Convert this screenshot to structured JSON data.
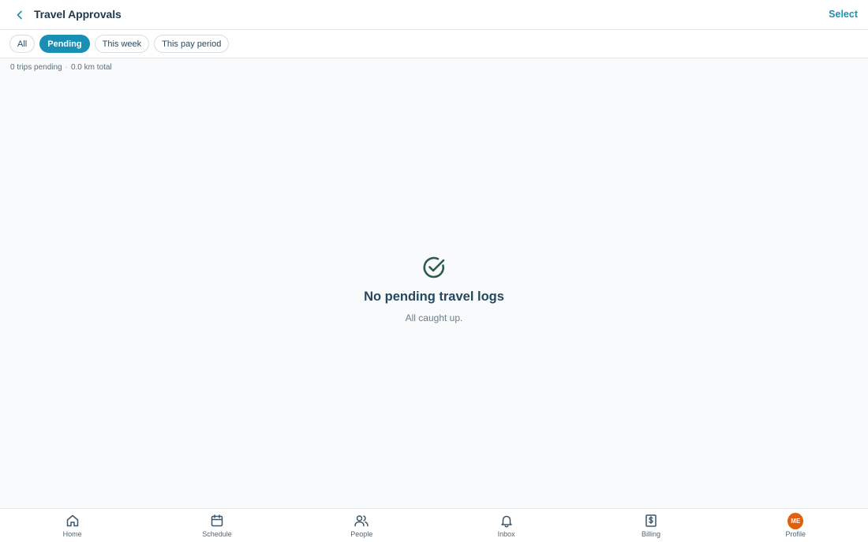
{
  "header": {
    "title": "Travel Approvals",
    "select_label": "Select"
  },
  "filters": [
    {
      "label": "All",
      "active": false
    },
    {
      "label": "Pending",
      "active": true
    },
    {
      "label": "This week",
      "active": false
    },
    {
      "label": "This pay period",
      "active": false
    }
  ],
  "summary": {
    "trips": "0 trips pending",
    "separator": "·",
    "distance": "0.0 km total"
  },
  "empty_state": {
    "icon": "check-circle-icon",
    "title": "No pending travel logs",
    "subtitle": "All caught up."
  },
  "bottom_nav": [
    {
      "label": "Home",
      "icon": "home-icon"
    },
    {
      "label": "Schedule",
      "icon": "calendar-icon"
    },
    {
      "label": "People",
      "icon": "people-icon"
    },
    {
      "label": "Inbox",
      "icon": "bell-icon"
    },
    {
      "label": "Billing",
      "icon": "billing-icon"
    },
    {
      "label": "Profile",
      "icon": "avatar",
      "initials": "ME"
    }
  ],
  "colors": {
    "accent": "#1a8fb4",
    "title": "#1f3a4d",
    "success": "#2d5a4a",
    "avatar": "#e0600f"
  }
}
